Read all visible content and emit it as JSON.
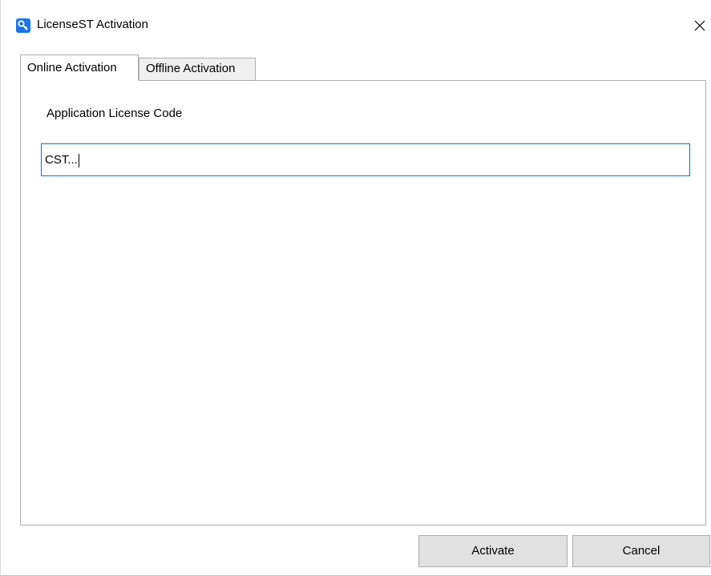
{
  "window": {
    "title": "LicenseST Activation",
    "app_icon": "key-icon",
    "close_icon": "close-icon"
  },
  "tabs": [
    {
      "label": "Online Activation",
      "active": true
    },
    {
      "label": "Offline Activation",
      "active": false
    }
  ],
  "online": {
    "field_label": "Application License Code",
    "license_code_value": "CST..."
  },
  "buttons": {
    "activate_label": "Activate",
    "cancel_label": "Cancel"
  },
  "colors": {
    "accent": "#0078d7",
    "icon_bg": "#1a73e8",
    "button_bg": "#e1e1e1"
  }
}
